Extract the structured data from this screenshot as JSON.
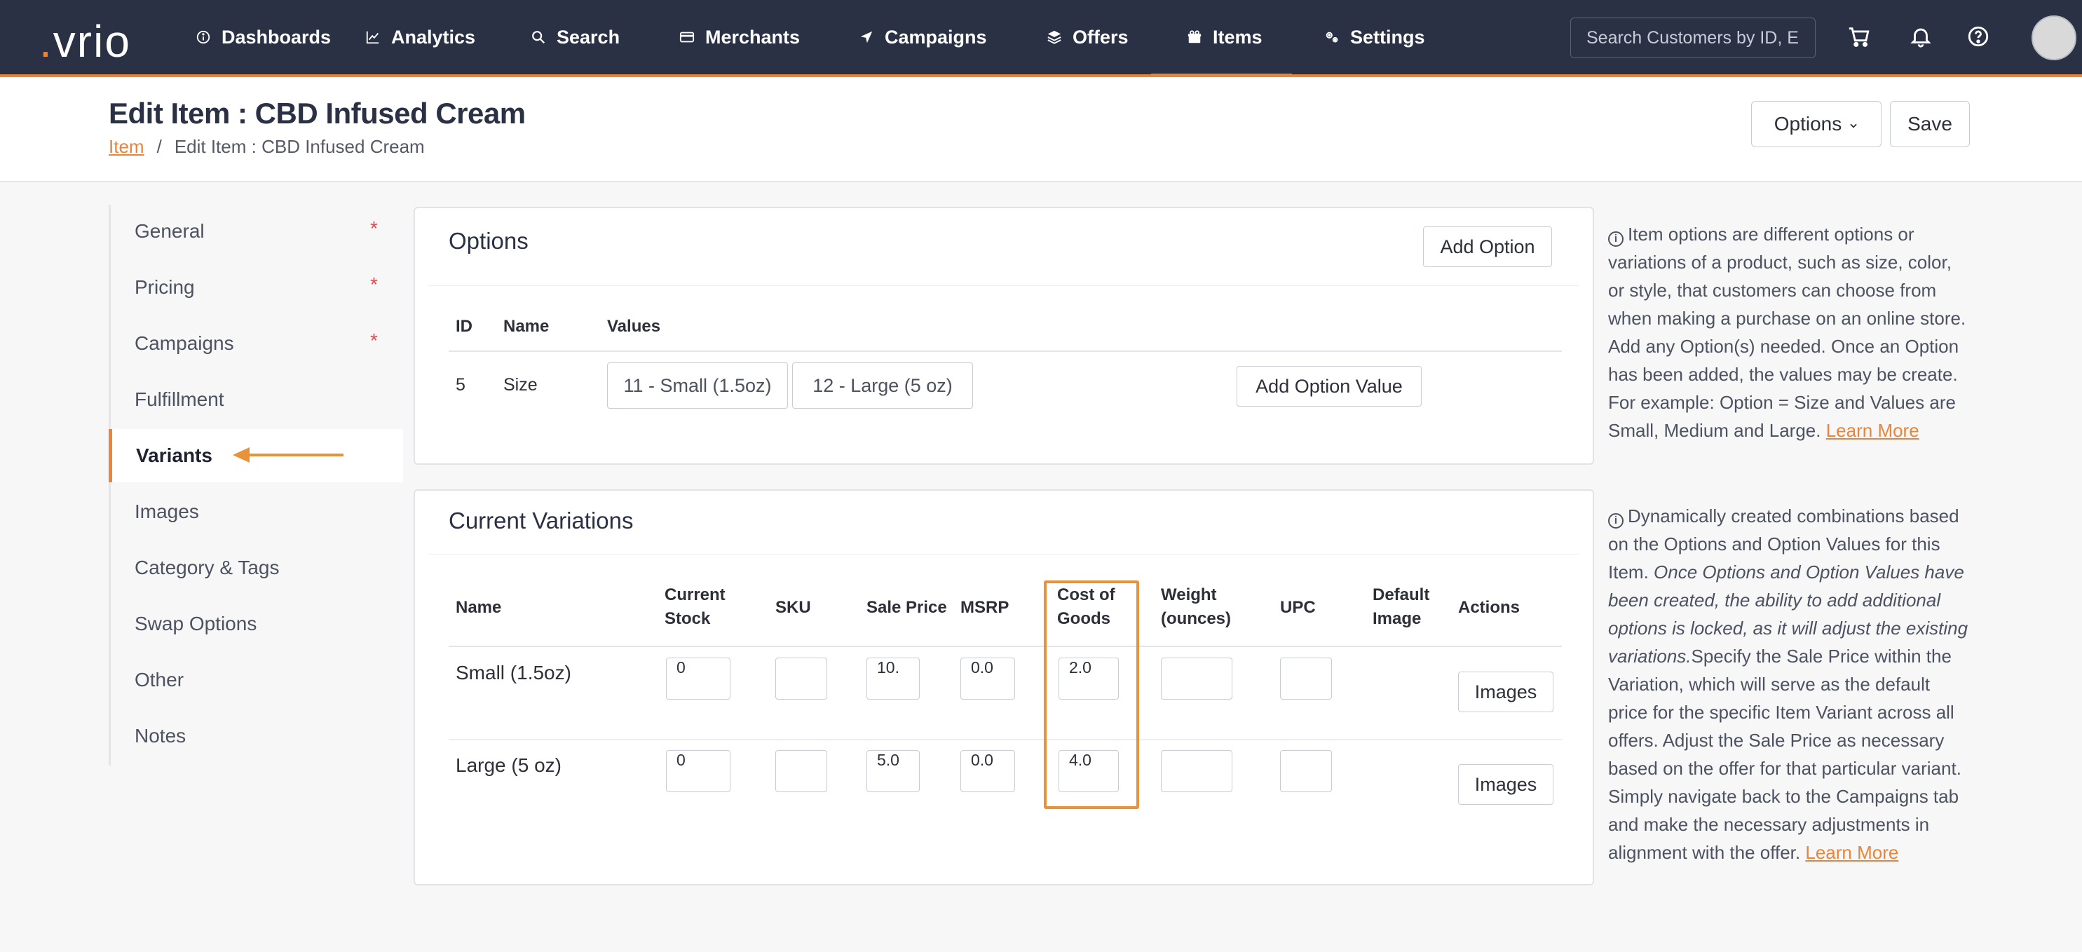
{
  "nav": {
    "logo": "vrio",
    "items": [
      {
        "label": "Dashboards",
        "icon": "info-circle-icon"
      },
      {
        "label": "Analytics",
        "icon": "line-chart-icon"
      },
      {
        "label": "Search",
        "icon": "search-icon"
      },
      {
        "label": "Merchants",
        "icon": "credit-card-icon"
      },
      {
        "label": "Campaigns",
        "icon": "send-icon"
      },
      {
        "label": "Offers",
        "icon": "layers-icon"
      },
      {
        "label": "Items",
        "icon": "gift-icon",
        "active": true
      },
      {
        "label": "Settings",
        "icon": "gears-icon"
      }
    ],
    "search_placeholder": "Search Customers by ID, En",
    "accent_color": "#e8853a",
    "bg_color": "#2a3145"
  },
  "header": {
    "title": "Edit Item : CBD Infused Cream",
    "breadcrumb_link": "Item",
    "breadcrumb_sep": "/",
    "breadcrumb_current": "Edit Item : CBD Infused Cream",
    "options_label": "Options",
    "save_label": "Save"
  },
  "sidebar": {
    "items": [
      {
        "label": "General",
        "required": "*"
      },
      {
        "label": "Pricing",
        "required": "*"
      },
      {
        "label": "Campaigns",
        "required": "*"
      },
      {
        "label": "Fulfillment"
      },
      {
        "label": "Variants",
        "active": true
      },
      {
        "label": "Images"
      },
      {
        "label": "Category & Tags"
      },
      {
        "label": "Swap Options"
      },
      {
        "label": "Other"
      },
      {
        "label": "Notes"
      }
    ]
  },
  "options_panel": {
    "title": "Options",
    "add_option_label": "Add Option",
    "columns": [
      "ID",
      "Name",
      "Values"
    ],
    "rows": [
      {
        "id": "5",
        "name": "Size",
        "values": [
          "11 - Small (1.5oz)",
          "12 - Large (5 oz)"
        ],
        "add_value_label": "Add Option Value"
      }
    ]
  },
  "variations_panel": {
    "title": "Current Variations",
    "columns": {
      "name": "Name",
      "current_stock": "Current Stock",
      "sku": "SKU",
      "sale_price": "Sale Price",
      "msrp": "MSRP",
      "cost_of_goods": "Cost of Goods",
      "weight": "Weight (ounces)",
      "upc": "UPC",
      "default_image": "Default Image",
      "actions": "Actions"
    },
    "rows": [
      {
        "name": "Small (1.5oz)",
        "current_stock": "0",
        "sku": "",
        "sale_price": "10.",
        "msrp": "0.0",
        "cost_of_goods": "2.0",
        "weight": "",
        "upc": "",
        "images_label": "Images"
      },
      {
        "name": "Large (5 oz)",
        "current_stock": "0",
        "sku": "",
        "sale_price": "5.0",
        "msrp": "0.0",
        "cost_of_goods": "4.0",
        "weight": "",
        "upc": "",
        "images_label": "Images"
      }
    ]
  },
  "help": {
    "options_text": "Item options are different options or variations of a product, such as size, color, or style, that customers can choose from when making a purchase on an online store. Add any Option(s) needed. Once an Option has been added, the values may be create. For example: Option = Size and Values are Small, Medium and Large.",
    "options_link": "Learn More",
    "variations_text_1": "Dynamically created combinations based on the Options and Option Values for this Item.",
    "variations_text_italic": "Once Options and Option Values have been created, the ability to add additional options is locked, as it will adjust the existing variations.",
    "variations_text_2": "Specify the Sale Price within the Variation, which will serve as the default price for the specific Item Variant across all offers. Adjust the Sale Price as necessary based on the offer for that particular variant. Simply navigate back to the Campaigns tab and make the necessary adjustments in alignment with the offer.",
    "variations_link": "Learn More"
  }
}
